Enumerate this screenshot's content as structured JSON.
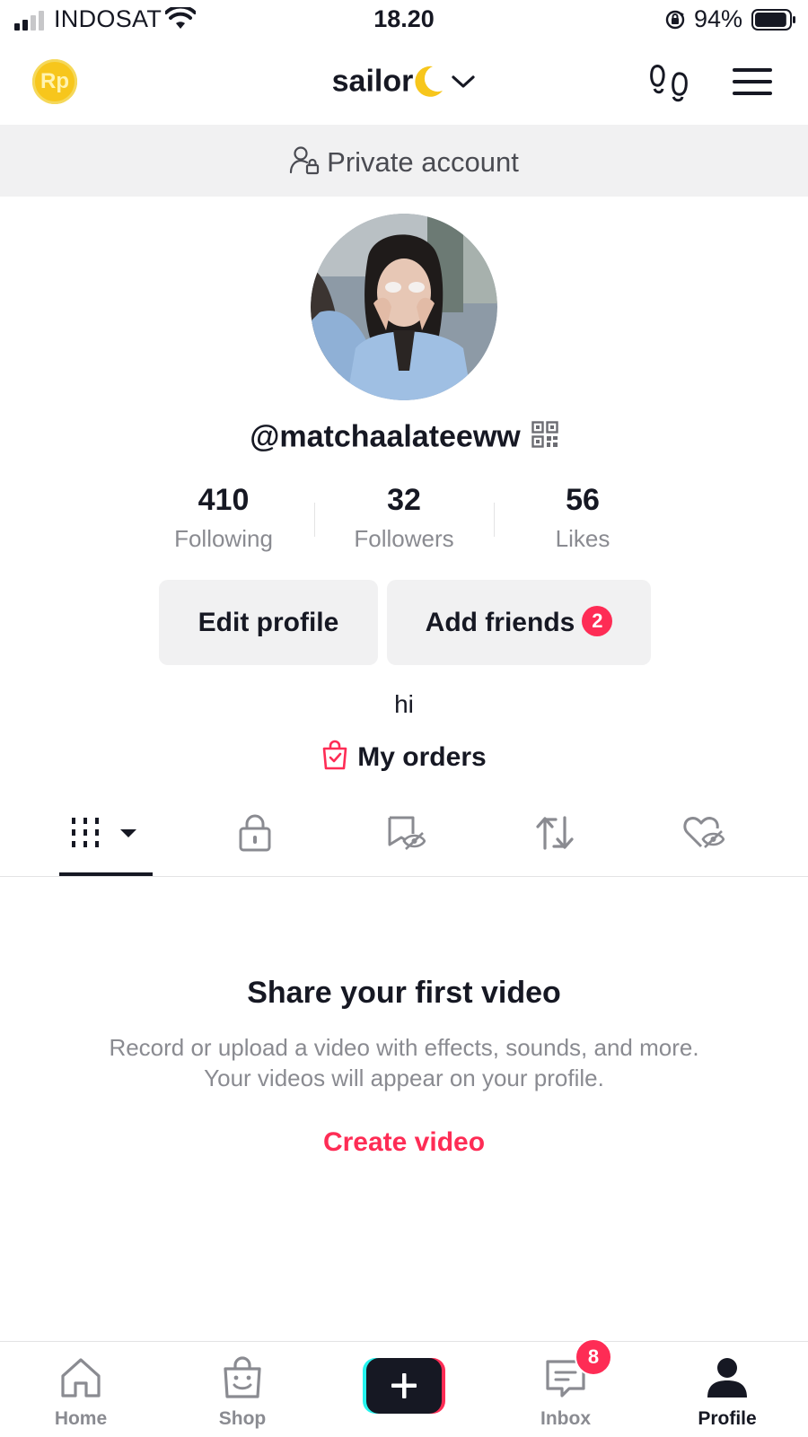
{
  "status_bar": {
    "carrier": "INDOSAT",
    "time": "18.20",
    "battery_percent": "94%",
    "battery_level": 0.94
  },
  "header": {
    "coin_label": "Rp",
    "username": "sailor",
    "username_emoji": "crescent-moon",
    "icons": [
      "coin-icon",
      "footprints-icon",
      "menu-icon",
      "chevron-down-icon"
    ]
  },
  "private_banner": {
    "text": "Private account"
  },
  "profile": {
    "handle": "@matchaalateeww",
    "stats": [
      {
        "value": "410",
        "label": "Following"
      },
      {
        "value": "32",
        "label": "Followers"
      },
      {
        "value": "56",
        "label": "Likes"
      }
    ],
    "edit_button": "Edit profile",
    "add_friends_button": "Add friends",
    "add_friends_badge": "2",
    "bio": "hi",
    "orders_label": "My orders"
  },
  "tabs": [
    {
      "name": "videos",
      "icon": "grid-icon",
      "active": true
    },
    {
      "name": "private",
      "icon": "lock-icon",
      "active": false
    },
    {
      "name": "saved",
      "icon": "bookmark-hidden-icon",
      "active": false
    },
    {
      "name": "reposts",
      "icon": "repost-icon",
      "active": false
    },
    {
      "name": "liked",
      "icon": "heart-hidden-icon",
      "active": false
    }
  ],
  "empty_state": {
    "title": "Share your first video",
    "line1": "Record or upload a video with effects, sounds, and more.",
    "line2": "Your videos will appear on your profile.",
    "cta": "Create video"
  },
  "bottom_nav": {
    "home": "Home",
    "shop": "Shop",
    "inbox": "Inbox",
    "inbox_badge": "8",
    "profile": "Profile"
  },
  "colors": {
    "accent": "#fe2c55",
    "text": "#161823",
    "muted": "#8a8b91",
    "surface": "#f1f1f2",
    "coin": "#f7c61c"
  }
}
